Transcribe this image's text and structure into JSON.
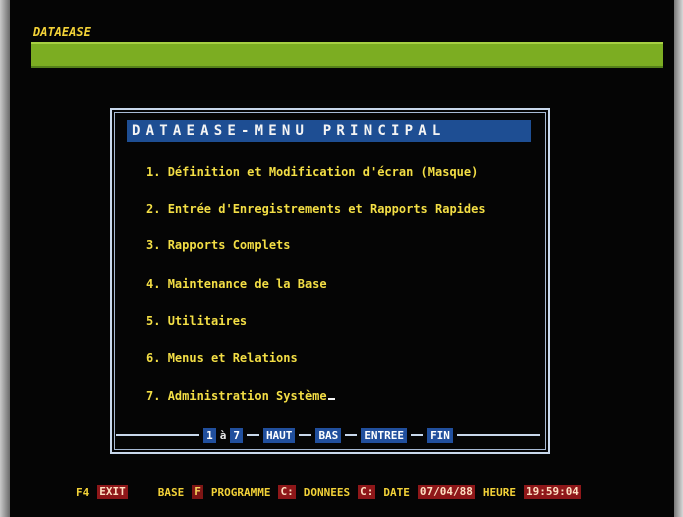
{
  "app": {
    "title": "DATAEASE"
  },
  "menu": {
    "title": "DATAEASE-MENU PRINCIPAL",
    "items": [
      {
        "number": "1.",
        "label": "Définition et Modification d'écran (Masque)"
      },
      {
        "number": "2.",
        "label": "Entrée d'Enregistrements et Rapports Rapides"
      },
      {
        "number": "3.",
        "label": "Rapports Complets"
      },
      {
        "number": "4.",
        "label": "Maintenance de la Base"
      },
      {
        "number": "5.",
        "label": "Utilitaires"
      },
      {
        "number": "6.",
        "label": "Menus et Relations"
      },
      {
        "number": "7.",
        "label": "Administration Système"
      }
    ]
  },
  "key_bar": {
    "from": "1",
    "to_word": "à",
    "to": "7",
    "haut": "HAUT",
    "bas": "BAS",
    "entree": "ENTREE",
    "fin": "FIN"
  },
  "status": {
    "f4_key": "F4",
    "exit": "EXIT",
    "base_label": "BASE",
    "base_value": "F",
    "programme_label": "PROGRAMME",
    "programme_value": "C:",
    "donnees_label": "DONNEES",
    "donnees_value": "C:",
    "date_label": "DATE",
    "date_value": "07/04/88",
    "heure_label": "HEURE",
    "heure_value": "19:59:04"
  },
  "colors": {
    "background": "#050505",
    "top_bar": "#7cad22",
    "title_bar": "#1e4e93",
    "menu_text": "#f3de45",
    "key_cap": "#214f9d",
    "status_chip": "#8e1719"
  }
}
